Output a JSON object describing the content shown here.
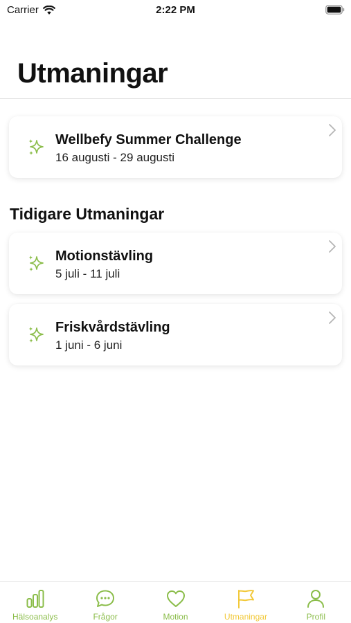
{
  "status_bar": {
    "carrier": "Carrier",
    "time": "2:22 PM"
  },
  "page": {
    "title": "Utmaningar"
  },
  "current_challenge": {
    "title": "Wellbefy Summer Challenge",
    "date": "16 augusti - 29 augusti"
  },
  "previous_section": {
    "heading": "Tidigare Utmaningar",
    "items": [
      {
        "title": "Motionstävling",
        "date": "5 juli - 11 juli"
      },
      {
        "title": "Friskvårdstävling",
        "date": "1 juni - 6 juni"
      }
    ]
  },
  "tab_bar": {
    "tabs": [
      {
        "label": "Hälsoanalys",
        "icon": "bar-chart-icon",
        "active": false
      },
      {
        "label": "Frågor",
        "icon": "chat-bubble-icon",
        "active": false
      },
      {
        "label": "Motion",
        "icon": "heart-icon",
        "active": false
      },
      {
        "label": "Utmaningar",
        "icon": "flag-icon",
        "active": true
      },
      {
        "label": "Profil",
        "icon": "person-icon",
        "active": false
      }
    ]
  },
  "colors": {
    "accent_green": "#8bbd4a",
    "active_yellow": "#f2c93a"
  }
}
